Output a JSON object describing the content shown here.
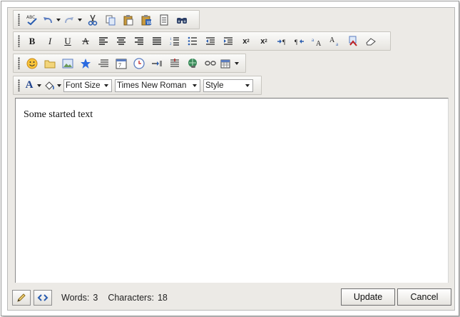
{
  "toolbar": {
    "row1": [
      "spellcheck-icon",
      "undo-icon",
      "redo-icon",
      "cut-icon",
      "copy-icon",
      "paste-icon",
      "paste-word-icon",
      "paste-text-icon",
      "find-icon"
    ],
    "row2": [
      "bold-icon",
      "italic-icon",
      "underline-icon",
      "strikethrough-icon",
      "align-left-icon",
      "align-center-icon",
      "align-right-icon",
      "justify-icon",
      "numbered-list-icon",
      "bullet-list-icon",
      "outdent-icon",
      "indent-icon",
      "superscript-icon",
      "subscript-icon",
      "ltr-icon",
      "rtl-icon",
      "uppercase-icon",
      "lowercase-icon",
      "format-painter-icon",
      "eraser-icon"
    ],
    "row3": [
      "emoticon-icon",
      "folder-icon",
      "image-icon",
      "star-icon",
      "hr-icon",
      "date-icon",
      "time-icon",
      "anchor-icon",
      "paragraph-icon",
      "hyperlink-icon",
      "unlink-icon",
      "insert-table-icon"
    ],
    "font_size": "Font Size",
    "font_name": "Times New Roman",
    "style": "Style"
  },
  "content": {
    "text": "Some started text"
  },
  "status": {
    "words_label": "Words:",
    "words": "3",
    "chars_label": "Characters:",
    "chars": "18"
  },
  "buttons": {
    "update": "Update",
    "cancel": "Cancel"
  },
  "colors": {
    "toolbar": "#eceae6",
    "border": "#7a7a7a",
    "icon_blue": "#2a5db0"
  }
}
